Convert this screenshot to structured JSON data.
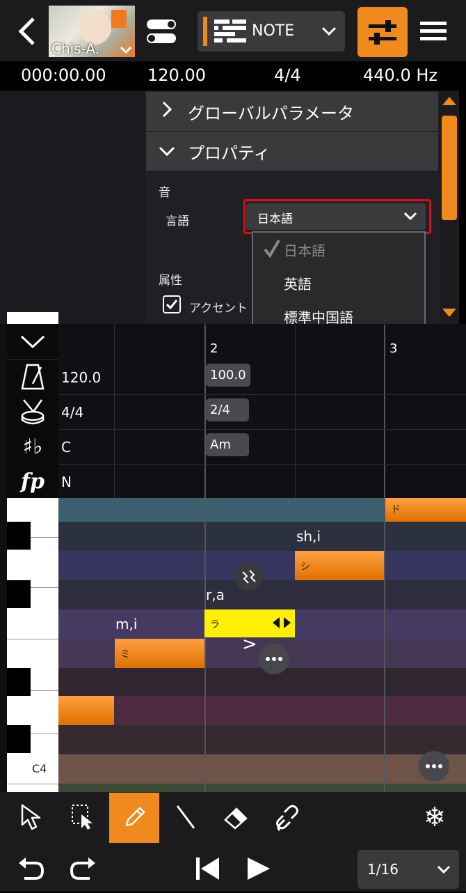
{
  "header": {
    "singer_name": "Chis-A.",
    "mode_label": "NOTE"
  },
  "info": {
    "time": "000:00.00",
    "tempo": "120.00",
    "beat": "4/4",
    "pitch": "440.0 Hz"
  },
  "panel": {
    "global_params": "グローバルパラメータ",
    "properties": "プロパティ",
    "sound_section": "音",
    "language_label": "言語",
    "language_value": "日本語",
    "language_options": [
      "日本語",
      "英語",
      "標準中国語"
    ],
    "attribute_section": "属性",
    "accent_label": "アクセント"
  },
  "ruler": {
    "measure2": "2",
    "measure3": "3"
  },
  "tracks": {
    "tempo_value": "120.0",
    "tempo_change": "100.0",
    "beat_value": "4/4",
    "beat_change": "2/4",
    "key_value": "C",
    "key_change": "Am",
    "dynamics_value": "N"
  },
  "notes": {
    "do": "ド",
    "shi": "シ",
    "ra": "ラ",
    "mi": "ミ",
    "lyric_shi": "sh,i",
    "lyric_ra": "r,a",
    "lyric_mi": "m,i"
  },
  "piano": {
    "c4_label": "C4"
  },
  "footer": {
    "page": "1/16"
  },
  "colors": {
    "accent": "#f08a1c",
    "highlight": "#e0081b",
    "note_yellow": "#ffef00"
  }
}
